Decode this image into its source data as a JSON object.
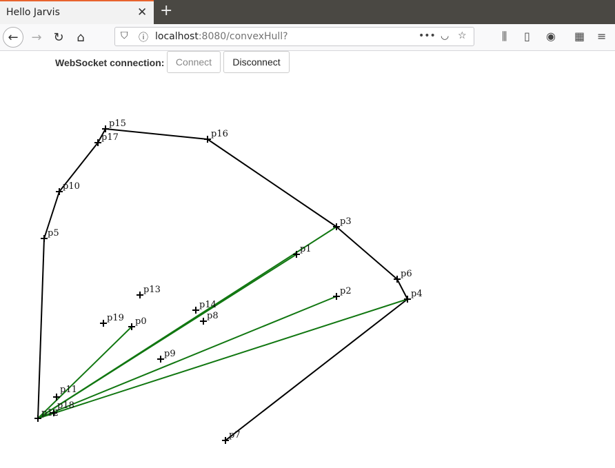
{
  "browser": {
    "tab_title": "Hello Jarvis",
    "url_host": "localhost",
    "url_rest": ":8080/convexHull?"
  },
  "page": {
    "ws_label": "WebSocket connection:",
    "connect_label": "Connect",
    "disconnect_label": "Disconnect"
  },
  "colors": {
    "hull_edge": "#000000",
    "candidate_edge": "#117711"
  },
  "icons": [
    "back-icon",
    "forward-icon",
    "reload-icon",
    "home-icon",
    "shield-icon",
    "info-icon",
    "more-icon",
    "pocket-icon",
    "star-icon",
    "library-icon",
    "sidebar-icon",
    "account-icon",
    "extensions-icon",
    "menu-icon"
  ]
}
